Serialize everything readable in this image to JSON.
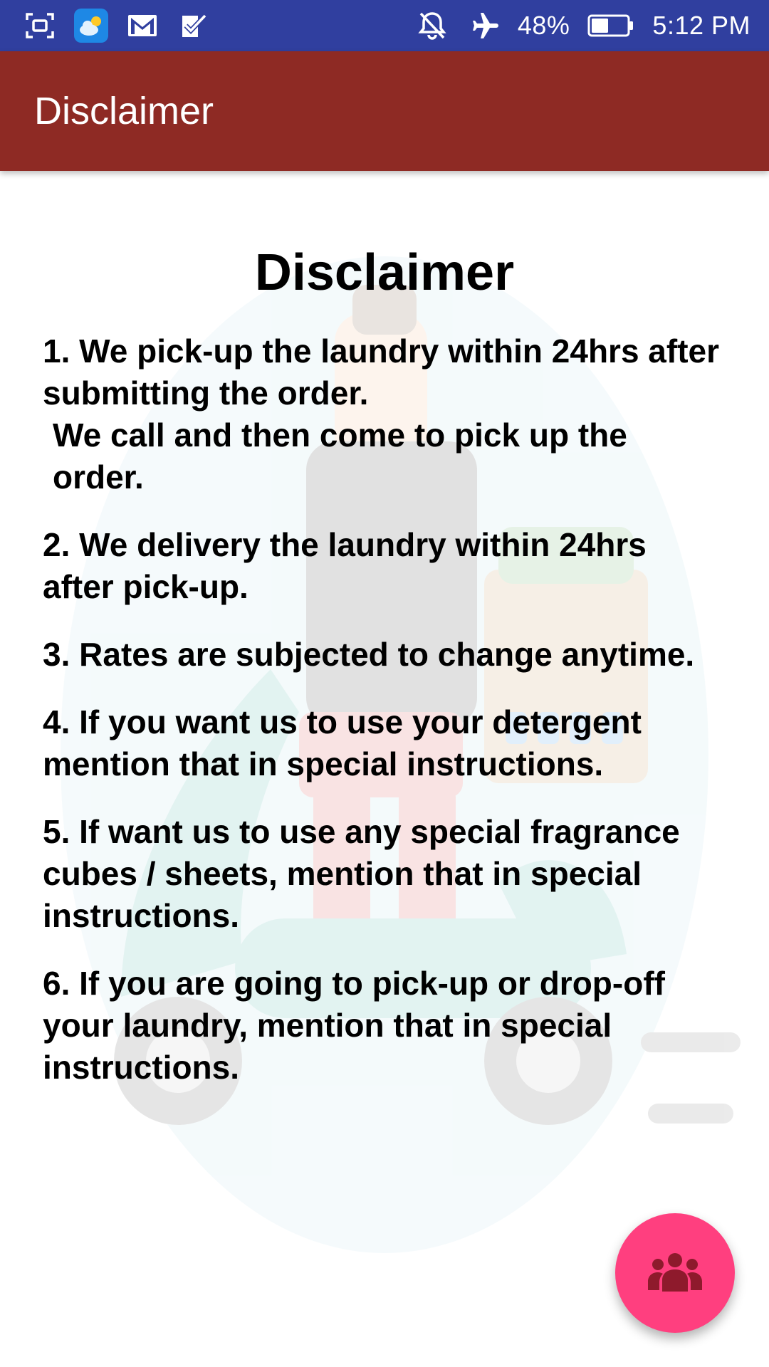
{
  "status_bar": {
    "icons_left": [
      "screenshot-icon",
      "weather-icon",
      "gmail-icon",
      "tasks-icon"
    ],
    "icons_right": [
      "notifications-off-icon",
      "airplane-mode-icon",
      "battery-icon"
    ],
    "battery_percent": "48%",
    "time": "5:12 PM",
    "battery_level": 0.48,
    "color": "#303f9f"
  },
  "app_bar": {
    "title": "Disclaimer",
    "color": "#8e2a24"
  },
  "content": {
    "heading": "Disclaimer",
    "items": [
      {
        "line1": "1. We pick-up the laundry within 24hrs after submitting the order.",
        "line2": "We call and then come to pick up the order."
      },
      {
        "line1": "2. We delivery the laundry within 24hrs after pick-up."
      },
      {
        "line1": "3. Rates are subjected to change anytime."
      },
      {
        "line1": "4. If you want us to use your detergent mention that in special instructions."
      },
      {
        "line1": "5. If want us to use any special fragrance cubes / sheets, mention that in special instructions."
      },
      {
        "line1": "6. If you are going to pick-up or drop-off your laundry, mention that in special instructions."
      }
    ],
    "background_image": "laundry-delivery-scooter-illustration"
  },
  "fab": {
    "icon": "group-icon",
    "color": "#ff3f7f",
    "icon_color": "#8e1a2c"
  }
}
